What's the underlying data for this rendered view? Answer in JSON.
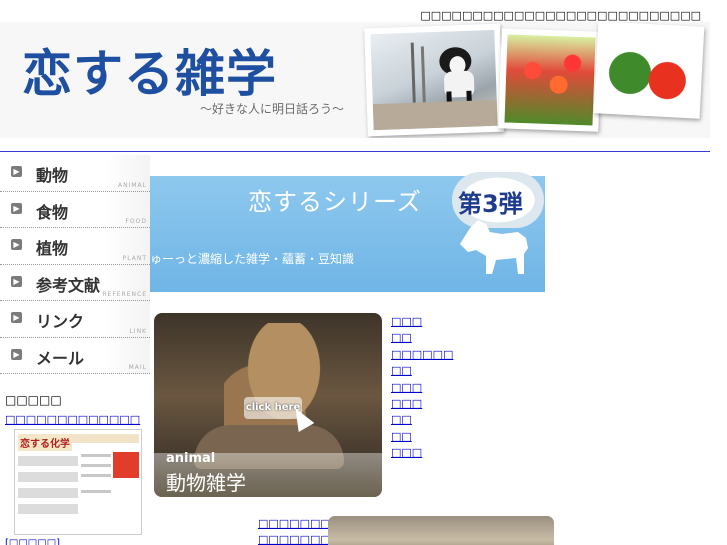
{
  "top_text": "□□□□□□□□□□□□□□□□□□□□□□□□□□□",
  "header": {
    "logo": "恋する雑学",
    "tagline": "〜好きな人に明日話ろう〜"
  },
  "nav": [
    {
      "label": "動物",
      "sub": "ANIMAL"
    },
    {
      "label": "食物",
      "sub": "FOOD"
    },
    {
      "label": "植物",
      "sub": "PLANT"
    },
    {
      "label": "参考文献",
      "sub": "REFERENCE"
    },
    {
      "label": "リンク",
      "sub": "LINK"
    },
    {
      "label": "メール",
      "sub": "MAIL"
    }
  ],
  "banner": {
    "title": "恋するシリーズ",
    "badge": "第3弾",
    "subtitle": "ゅーっと濃縮した雑学・蘊蓄・豆知識"
  },
  "sidebar": {
    "heading": "□□□□□",
    "link": "□□□□□□□□□□□□□",
    "thumb_title": "恋する化学",
    "bottom_link": "[□□□□□]"
  },
  "animal_card": {
    "button": "click here",
    "en": "animal",
    "jp": "動物雑学"
  },
  "links": [
    "□□□",
    "□□",
    "□□□□□□",
    "□□",
    "□□□",
    "□□□",
    "□□",
    "□□",
    "□□□"
  ],
  "links2": [
    "□□□□□□□□□",
    "□□□□□□□□"
  ]
}
